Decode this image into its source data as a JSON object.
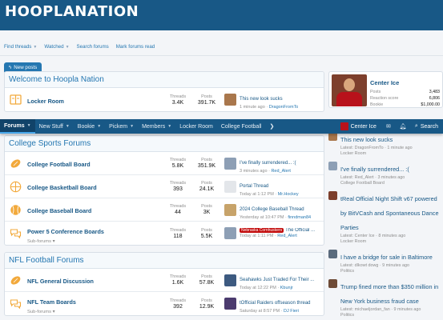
{
  "header": {
    "logo": "HOOPLANATION"
  },
  "subnav": {
    "find_threads": "Find threads",
    "watched": "Watched",
    "search_forums": "Search forums",
    "mark_read": "Mark forums read"
  },
  "actions": {
    "new_posts": "New posts"
  },
  "sticky_nav": {
    "items": [
      "Forums",
      "New Stuff",
      "Bookie",
      "Pickem",
      "Members",
      "Locker Room",
      "College Football"
    ],
    "user": "Center Ice",
    "search": "Search"
  },
  "blocks": [
    {
      "title": "Welcome to Hoopla Nation",
      "nodes": [
        {
          "title": "Locker Room",
          "threads_label": "Threads",
          "threads": "3.4K",
          "posts_label": "Posts",
          "posts": "391.7K",
          "latest_title": "This new look sucks",
          "latest_time": "1 minute ago",
          "latest_user": "DragonFromTo"
        }
      ]
    },
    {
      "title": "College Sports Forums",
      "nodes": [
        {
          "title": "College Football Board",
          "threads_label": "Threads",
          "threads": "5.8K",
          "posts_label": "Posts",
          "posts": "351.9K",
          "latest_title": "I've finally surrendered... :(",
          "latest_time": "3 minutes ago",
          "latest_user": "Red_Alert"
        },
        {
          "title": "College Basketball Board",
          "threads_label": "Threads",
          "threads": "393",
          "posts_label": "Posts",
          "posts": "24.1K",
          "latest_title": "Portal Thread",
          "latest_time": "Today at 1:12 PM",
          "latest_user": "Mr.Hockey"
        },
        {
          "title": "College Baseball Board",
          "threads_label": "Threads",
          "threads": "44",
          "posts_label": "Posts",
          "posts": "3K",
          "latest_title": "2024 College Baseball Thread",
          "latest_time": "Yesterday at 10:47 PM",
          "latest_user": "finndman84"
        },
        {
          "title": "Power 5 Conference Boards",
          "sub": "Sub-forums",
          "threads_label": "Threads",
          "threads": "118",
          "posts_label": "Posts",
          "posts": "5.5K",
          "latest_prefix": "Nebraska Cornhuskers",
          "latest_title": "The Official ...",
          "latest_time": "Today at 1:11 PM",
          "latest_user": "Red_Alert"
        }
      ]
    },
    {
      "title": "NFL Football Forums",
      "nodes": [
        {
          "title": "NFL General Discussion",
          "threads_label": "Threads",
          "threads": "1.6K",
          "posts_label": "Posts",
          "posts": "57.8K",
          "latest_title": "Seahawks Just Traded For Their ...",
          "latest_time": "Today at 12:22 PM",
          "latest_user": "Kbunjr"
        },
        {
          "title": "NFL Team Boards",
          "sub": "Sub-forums",
          "threads_label": "Threads",
          "threads": "392",
          "posts_label": "Posts",
          "posts": "12.9K",
          "latest_title": "tOfficial Raiders offseason thread",
          "latest_time": "Saturday at 8:57 PM",
          "latest_user": "DJ Fieri"
        }
      ]
    }
  ],
  "member": {
    "name": "Center Ice",
    "posts_label": "Posts",
    "posts": "3,483",
    "reaction_label": "Reaction score",
    "reaction": "6,806",
    "bookie_label": "Bookie",
    "bookie": "$1,000.00"
  },
  "side_items": [
    {
      "title": "This new look sucks",
      "meta": "Latest: DragonFromTo · 1 minute ago",
      "forum": "Locker Room"
    },
    {
      "title": "I've finally surrendered... :(",
      "meta": "Latest: Red_Alert · 3 minutes ago",
      "forum": "College Football Board"
    },
    {
      "title": "tReal Official Night Shift v67 powered by BitVCash and Spontaneous Dance Parties",
      "meta": "Latest: Center Ice · 8 minutes ago",
      "forum": "Locker Room"
    },
    {
      "title": "I have a bridge for sale in Baltimore",
      "meta": "Latest: dlkowt dowg · 9 minutes ago",
      "forum": "Politics"
    },
    {
      "title": "Trump fined more than $350 million in New York business fraud case",
      "meta": "Latest: michaeljordan_fan · 9 minutes ago",
      "forum": "Politics"
    }
  ],
  "colors": {
    "brand": "#185886",
    "link": "#2577b1",
    "accent_icon": "#f2a93b",
    "prefix_red": "#c20a0a"
  }
}
